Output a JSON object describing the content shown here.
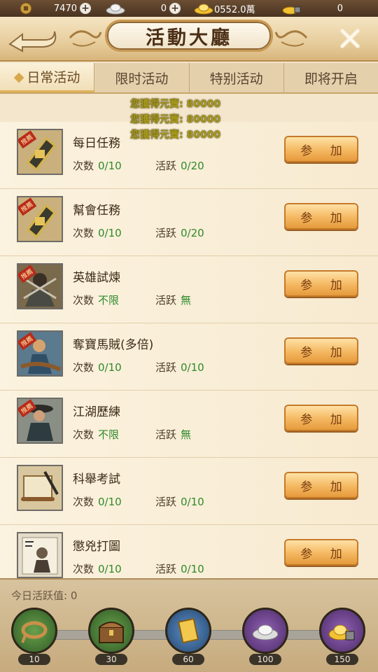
{
  "resources": {
    "copper": "7470",
    "silver": "0",
    "gold_ingot": "0552.0萬",
    "locked_ingot": "0"
  },
  "header": {
    "title": "活動大廳"
  },
  "tabs": [
    "日常活动",
    "限时活动",
    "特别活动",
    "即将开启"
  ],
  "reward_notices": [
    "您獲得元寶: 80000",
    "您獲得元寶: 80000",
    "您獲得元寶: 80000"
  ],
  "labels": {
    "count": "次数",
    "active": "活跃",
    "join": "参 加",
    "recommend": "推薦"
  },
  "activities": [
    {
      "name": "每日任務",
      "count": "0/10",
      "active": "0/20",
      "recommended": true,
      "icon": "token-icon"
    },
    {
      "name": "幫會任務",
      "count": "0/10",
      "active": "0/20",
      "recommended": true,
      "icon": "token-icon"
    },
    {
      "name": "英雄試煉",
      "count": "不限",
      "active": "無",
      "recommended": true,
      "icon": "warrior-icon"
    },
    {
      "name": "奪寶馬賊(多倍)",
      "count": "0/10",
      "active": "0/10",
      "recommended": true,
      "icon": "bandit-icon"
    },
    {
      "name": "江湖歷練",
      "count": "不限",
      "active": "無",
      "recommended": true,
      "icon": "swordsman-icon"
    },
    {
      "name": "科舉考試",
      "count": "0/10",
      "active": "0/10",
      "recommended": false,
      "icon": "scroll-brush-icon"
    },
    {
      "name": "懲兇打圖",
      "count": "0/10",
      "active": "0/10",
      "recommended": false,
      "icon": "wanted-poster-icon"
    }
  ],
  "footer": {
    "today_label": "今日活跃值:",
    "today_value": "0",
    "milestones": [
      {
        "value": "10",
        "icon": "rope-icon",
        "color": "green"
      },
      {
        "value": "30",
        "icon": "chest-icon",
        "color": "green"
      },
      {
        "value": "60",
        "icon": "scroll-icon",
        "color": "blue"
      },
      {
        "value": "100",
        "icon": "silver-ingot-icon",
        "color": "purple"
      },
      {
        "value": "150",
        "icon": "gold-ingot-lock-icon",
        "color": "purple"
      }
    ]
  }
}
